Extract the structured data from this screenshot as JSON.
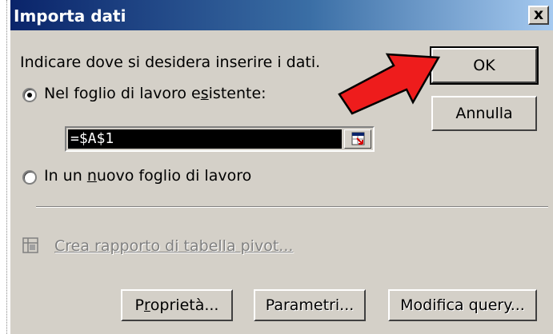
{
  "dialog": {
    "title": "Importa dati",
    "close_glyph": "x",
    "prompt": "Indicare dove si desidera inserire i dati.",
    "option_existing": {
      "label_before": "Nel foglio di lavoro e",
      "label_underlined": "s",
      "label_after": "istente:",
      "selected": true
    },
    "cell_reference": "=$A$1",
    "option_new": {
      "label_before": "In un ",
      "label_underlined": "n",
      "label_after": "uovo foglio di lavoro",
      "selected": false
    },
    "pivot_link": "Crea rapporto di tabella pivot...",
    "buttons": {
      "ok": "OK",
      "cancel": "Annulla",
      "properties_before": "P",
      "properties_underlined": "r",
      "properties_after": "oprietà...",
      "parameters": "Parametri...",
      "edit_query": "Modifica query..."
    }
  },
  "colors": {
    "title_gradient_start": "#0a246a",
    "title_gradient_end": "#a6caf0",
    "arrow_fill": "#ee1c1c",
    "dialog_bg": "#d4d0c8"
  },
  "icons": [
    "close-icon",
    "range-selector-icon",
    "pivot-table-icon",
    "red-arrow"
  ]
}
